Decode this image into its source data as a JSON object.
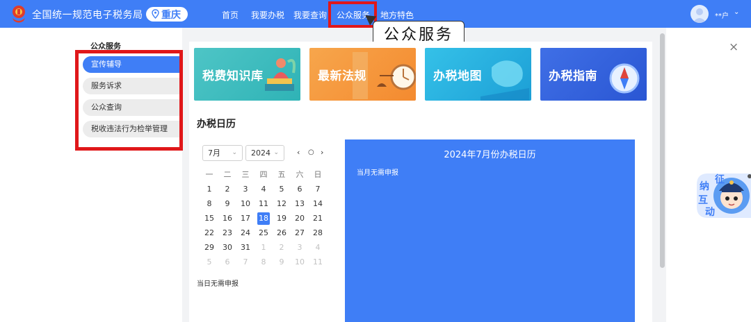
{
  "header": {
    "site_title": "全国统一规范电子税务局",
    "region": "重庆",
    "nav": [
      {
        "label": "首页"
      },
      {
        "label": "我要办税"
      },
      {
        "label": "我要查询"
      },
      {
        "label": "公众服务"
      },
      {
        "label": "地方特色"
      }
    ],
    "active_nav": "公众服务",
    "user_name": "**户",
    "user_caret": "⌄"
  },
  "tooltip": {
    "text": "公众服务"
  },
  "sidebar": {
    "title": "公众服务",
    "items": [
      {
        "label": "宣传辅导"
      },
      {
        "label": "服务诉求"
      },
      {
        "label": "公众查询"
      },
      {
        "label": "税收违法行为检举管理"
      }
    ]
  },
  "banners": [
    {
      "title": "税费知识库"
    },
    {
      "title": "最新法规"
    },
    {
      "title": "办税地图"
    },
    {
      "title": "办税指南"
    }
  ],
  "calendar": {
    "section_title": "办税日历",
    "month_select": "7月",
    "year_select": "2024",
    "nav_prev": "‹",
    "nav_today": "○",
    "nav_next": "›",
    "weekdays": [
      "一",
      "二",
      "三",
      "四",
      "五",
      "六",
      "日"
    ],
    "weeks": [
      [
        "1",
        "2",
        "3",
        "4",
        "5",
        "6",
        "7"
      ],
      [
        "8",
        "9",
        "10",
        "11",
        "12",
        "13",
        "14"
      ],
      [
        "15",
        "16",
        "17",
        "18",
        "19",
        "20",
        "21"
      ],
      [
        "22",
        "23",
        "24",
        "25",
        "26",
        "27",
        "28"
      ],
      [
        "29",
        "30",
        "31",
        "1",
        "2",
        "3",
        "4"
      ],
      [
        "5",
        "6",
        "7",
        "8",
        "9",
        "10",
        "11"
      ]
    ],
    "selected_day": "18",
    "day_note": "当日无需申报",
    "month_panel_title": "2024年7月份办税日历",
    "month_note": "当月无需申报"
  },
  "assistant": {
    "chars": [
      "征",
      "纳",
      "互",
      "动"
    ]
  },
  "close_label": "×",
  "colors": {
    "primary": "#3f7ef6",
    "highlight": "#e0171a"
  }
}
